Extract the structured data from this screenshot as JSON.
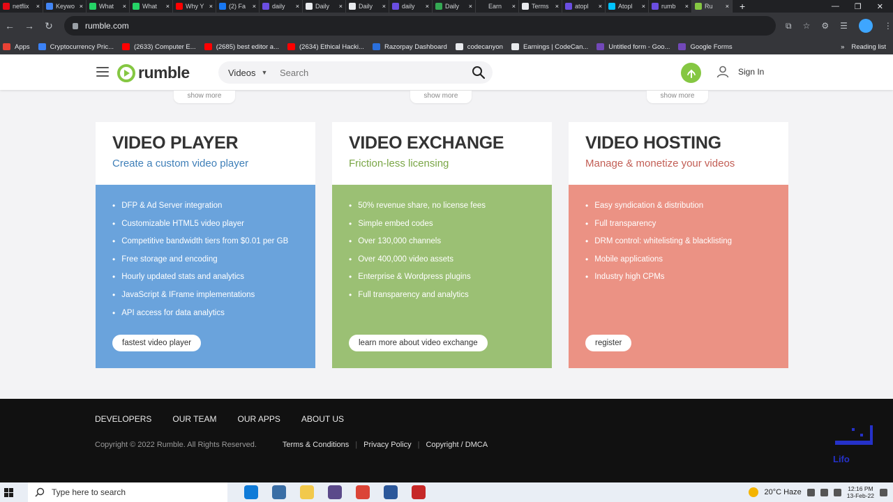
{
  "browser": {
    "tabs": [
      {
        "label": "netflix",
        "color": "#e50914"
      },
      {
        "label": "Keywo",
        "color": "#4285f4"
      },
      {
        "label": "What",
        "color": "#25d366"
      },
      {
        "label": "What",
        "color": "#25d366"
      },
      {
        "label": "Why Y",
        "color": "#ff0000"
      },
      {
        "label": "(2) Fa",
        "color": "#1877f2"
      },
      {
        "label": "daily",
        "color": "#6a4ee1"
      },
      {
        "label": "Daily",
        "color": "#e8eaed"
      },
      {
        "label": "Daily",
        "color": "#e8eaed"
      },
      {
        "label": "daily",
        "color": "#6a4ee1"
      },
      {
        "label": "Daily",
        "color": "#34a853"
      },
      {
        "label": "Earn",
        "color": "#202124"
      },
      {
        "label": "Terms",
        "color": "#e8eaed"
      },
      {
        "label": "atopl",
        "color": "#6a4ee1"
      },
      {
        "label": "Atopl",
        "color": "#00c3ff"
      },
      {
        "label": "rumb",
        "color": "#6a4ee1"
      },
      {
        "label": "Ru",
        "color": "#85c742",
        "active": true
      }
    ],
    "new_tab": "+",
    "url": "rumble.com",
    "bookmarks": [
      {
        "label": "Apps",
        "color": "#e94235"
      },
      {
        "label": "Cryptocurrency Pric...",
        "color": "#3b82f6"
      },
      {
        "label": "(2633) Computer E...",
        "color": "#ff0000"
      },
      {
        "label": "(2685) best editor a...",
        "color": "#ff0000"
      },
      {
        "label": "(2634) Ethical Hacki...",
        "color": "#ff0000"
      },
      {
        "label": "Razorpay Dashboard",
        "color": "#2a6fdb"
      },
      {
        "label": "codecanyon",
        "color": "#e8eaed"
      },
      {
        "label": "Earnings | CodeCan...",
        "color": "#e8eaed"
      },
      {
        "label": "Untitled form - Goo...",
        "color": "#7248b9"
      },
      {
        "label": "Google Forms",
        "color": "#7248b9"
      }
    ],
    "reading_list": "Reading list"
  },
  "header": {
    "logo_text": "rumble",
    "search_category": "Videos",
    "search_placeholder": "Search",
    "sign_in": "Sign In"
  },
  "show_more": "show more",
  "cards": [
    {
      "title": "VIDEO PLAYER",
      "subtitle": "Create a custom video player",
      "subtitle_color": "#3f7fb8",
      "bg": "#6aa3dc",
      "items": [
        "DFP & Ad Server integration",
        "Customizable HTML5 video player",
        "Competitive bandwidth tiers from $0.01 per GB",
        "Free storage and encoding",
        "Hourly updated stats and analytics",
        "JavaScript & IFrame implementations",
        "API access for data analytics"
      ],
      "button": "fastest video player"
    },
    {
      "title": "VIDEO EXCHANGE",
      "subtitle": "Friction-less licensing",
      "subtitle_color": "#7aa646",
      "bg": "#9bc074",
      "items": [
        "50% revenue share, no license fees",
        "Simple embed codes",
        "Over 130,000 channels",
        "Over 400,000 video assets",
        "Enterprise & Wordpress plugins",
        "Full transparency and analytics"
      ],
      "button": "learn more about video exchange"
    },
    {
      "title": "VIDEO HOSTING",
      "subtitle": "Manage & monetize your videos",
      "subtitle_color": "#c25e55",
      "bg": "#eb9284",
      "items": [
        "Easy syndication & distribution",
        "Full transparency",
        "DRM control: whitelisting & blacklisting",
        "Mobile applications",
        "Industry high CPMs"
      ],
      "button": "register"
    }
  ],
  "footer": {
    "nav": [
      "DEVELOPERS",
      "OUR TEAM",
      "OUR APPS",
      "ABOUT US"
    ],
    "copyright": "Copyright © 2022 Rumble. All Rights Reserved.",
    "links": [
      "Terms & Conditions",
      "Privacy Policy",
      "Copyright / DMCA"
    ],
    "watermark": "Lifo"
  },
  "taskbar": {
    "search_placeholder": "Type here to search",
    "weather": "20°C Haze",
    "time": "12:16 PM",
    "date": "13-Feb-22",
    "apps": [
      {
        "name": "edge-icon",
        "color": "#0f7bd8"
      },
      {
        "name": "store-icon",
        "color": "#3a6ea5"
      },
      {
        "name": "file-explorer-icon",
        "color": "#f2c94c"
      },
      {
        "name": "media-icon",
        "color": "#5b4a8a"
      },
      {
        "name": "chrome-icon",
        "color": "#db4437"
      },
      {
        "name": "word-icon",
        "color": "#2b579a"
      },
      {
        "name": "recorder-icon",
        "color": "#c62828"
      }
    ]
  }
}
